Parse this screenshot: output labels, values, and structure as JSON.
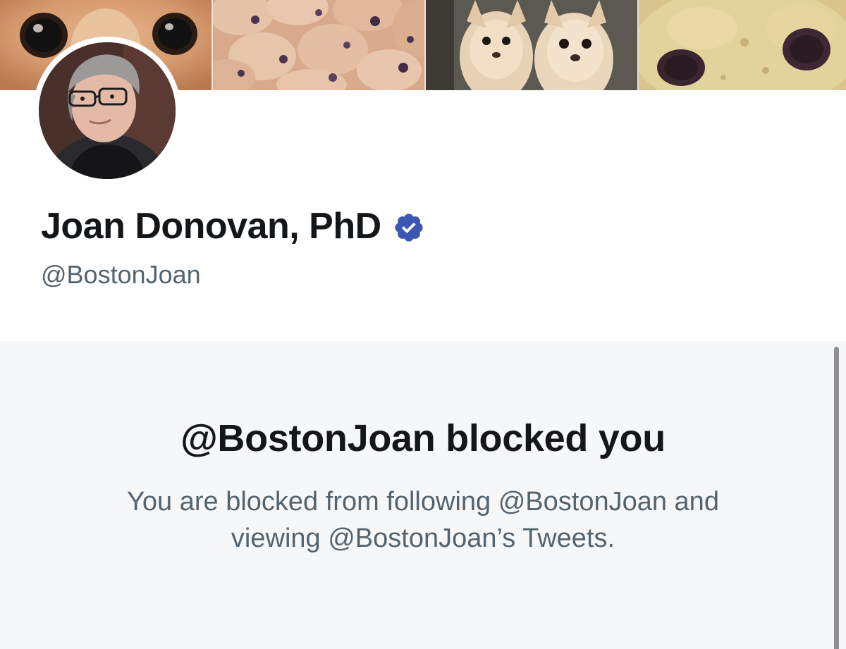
{
  "profile": {
    "name": "Joan Donovan, PhD",
    "handle": "@BostonJoan",
    "verified": true
  },
  "blocked": {
    "title": "@BostonJoan blocked you",
    "description_line1": "You are blocked from following @BostonJoan and",
    "description_line2": "viewing @BostonJoan’s Tweets."
  },
  "icons": {
    "verified": "verified-badge-icon"
  },
  "colors": {
    "name_text": "#14171a",
    "secondary_text": "#536471",
    "verified_badge": "#3d56b2",
    "panel_background": "#f6f7f9"
  }
}
